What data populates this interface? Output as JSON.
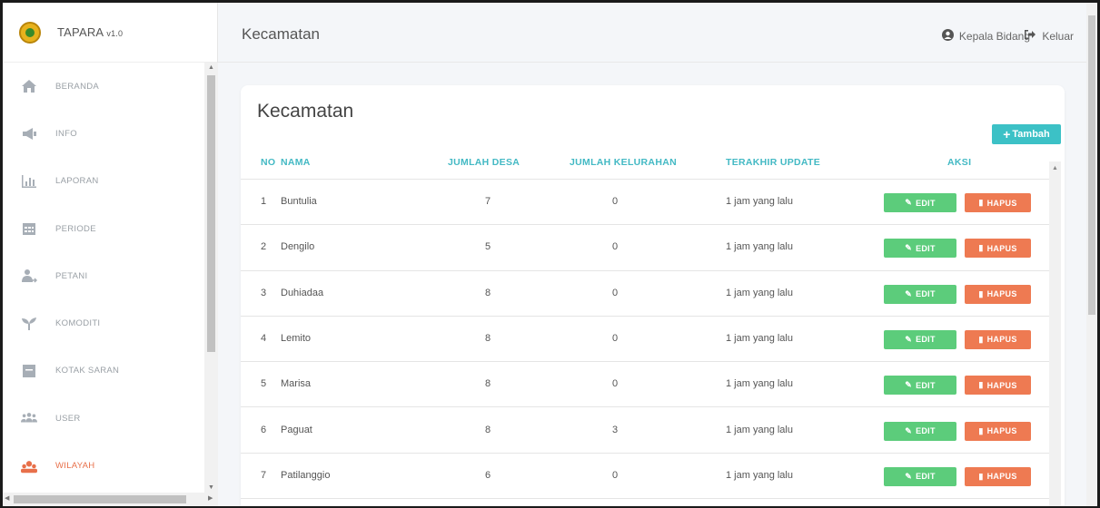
{
  "app": {
    "name": "TAPARA",
    "version": "v1.0"
  },
  "header": {
    "title": "Kecamatan",
    "user_label": "Kepala Bidang",
    "logout_label": "Keluar"
  },
  "sidebar": {
    "items": [
      {
        "label": "BERANDA",
        "icon": "home-icon",
        "active": false
      },
      {
        "label": "INFO",
        "icon": "megaphone-icon",
        "active": false
      },
      {
        "label": "LAPORAN",
        "icon": "bar-chart-icon",
        "active": false
      },
      {
        "label": "PERIODE",
        "icon": "calendar-icon",
        "active": false
      },
      {
        "label": "PETANI",
        "icon": "users-icon",
        "active": false
      },
      {
        "label": "KOMODITI",
        "icon": "sprout-icon",
        "active": false
      },
      {
        "label": "KOTAK SARAN",
        "icon": "inbox-icon",
        "active": false
      },
      {
        "label": "USER",
        "icon": "group-icon",
        "active": false
      },
      {
        "label": "WILAYAH",
        "icon": "map-users-icon",
        "active": true
      }
    ]
  },
  "card": {
    "title": "Kecamatan",
    "add_label": "Tambah"
  },
  "table": {
    "columns": [
      "NO",
      "NAMA",
      "JUMLAH DESA",
      "JUMLAH KELURAHAN",
      "TERAKHIR UPDATE",
      "AKSI"
    ],
    "edit_label": "EDIT",
    "delete_label": "HAPUS",
    "rows": [
      {
        "no": "1",
        "nama": "Buntulia",
        "desa": "7",
        "kelurahan": "0",
        "update": "1 jam yang lalu"
      },
      {
        "no": "2",
        "nama": "Dengilo",
        "desa": "5",
        "kelurahan": "0",
        "update": "1 jam yang lalu"
      },
      {
        "no": "3",
        "nama": "Duhiadaa",
        "desa": "8",
        "kelurahan": "0",
        "update": "1 jam yang lalu"
      },
      {
        "no": "4",
        "nama": "Lemito",
        "desa": "8",
        "kelurahan": "0",
        "update": "1 jam yang lalu"
      },
      {
        "no": "5",
        "nama": "Marisa",
        "desa": "8",
        "kelurahan": "0",
        "update": "1 jam yang lalu"
      },
      {
        "no": "6",
        "nama": "Paguat",
        "desa": "8",
        "kelurahan": "3",
        "update": "1 jam yang lalu"
      },
      {
        "no": "7",
        "nama": "Patilanggio",
        "desa": "6",
        "kelurahan": "0",
        "update": "1 jam yang lalu"
      }
    ]
  },
  "colors": {
    "accent": "#3cc1c6",
    "edit": "#5ccc7b",
    "delete": "#ee7a52",
    "active_menu": "#e8704a"
  }
}
